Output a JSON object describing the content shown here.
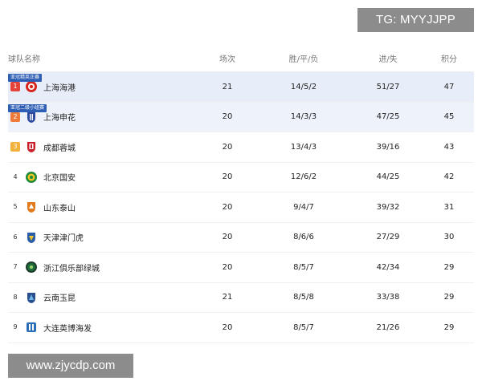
{
  "watermarks": {
    "top": "TG: MYYJJPP",
    "bottom": "www.zjycdp.com"
  },
  "header": {
    "team": "球队名称",
    "played": "场次",
    "wdl": "胜/平/负",
    "goals": "进/失",
    "points": "积分"
  },
  "rows": [
    {
      "rank": "1",
      "badge": "亚冠精英正赛",
      "team": "上海海港",
      "played": "21",
      "wdl": "14/5/2",
      "goals": "51/27",
      "points": "47",
      "logo_color": "#d7261e"
    },
    {
      "rank": "2",
      "badge": "亚冠二级小组赛",
      "team": "上海申花",
      "played": "20",
      "wdl": "14/3/3",
      "goals": "47/25",
      "points": "45",
      "logo_color": "#2b4aa0"
    },
    {
      "rank": "3",
      "team": "成都蓉城",
      "played": "20",
      "wdl": "13/4/3",
      "goals": "39/16",
      "points": "43",
      "logo_color": "#c8202a"
    },
    {
      "rank": "4",
      "team": "北京国安",
      "played": "20",
      "wdl": "12/6/2",
      "goals": "44/25",
      "points": "42",
      "logo_color": "#1f8a3a"
    },
    {
      "rank": "5",
      "team": "山东泰山",
      "played": "20",
      "wdl": "9/4/7",
      "goals": "39/32",
      "points": "31",
      "logo_color": "#e07a1c"
    },
    {
      "rank": "6",
      "team": "天津津门虎",
      "played": "20",
      "wdl": "8/6/6",
      "goals": "27/29",
      "points": "30",
      "logo_color": "#2a5ca8"
    },
    {
      "rank": "7",
      "team": "浙江俱乐部绿城",
      "played": "20",
      "wdl": "8/5/7",
      "goals": "42/34",
      "points": "29",
      "logo_color": "#1d6e3a"
    },
    {
      "rank": "8",
      "team": "云南玉昆",
      "played": "21",
      "wdl": "8/5/8",
      "goals": "33/38",
      "points": "29",
      "logo_color": "#2a4f8f"
    },
    {
      "rank": "9",
      "team": "大连英博海发",
      "played": "20",
      "wdl": "8/5/7",
      "goals": "21/26",
      "points": "29",
      "logo_color": "#2a6fb8"
    }
  ]
}
